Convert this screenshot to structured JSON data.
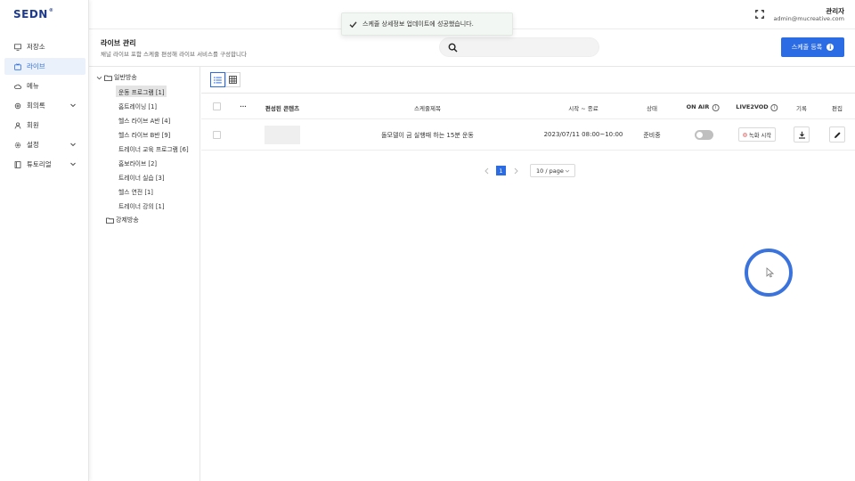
{
  "brand": {
    "logo": "SEDN",
    "logo_mark": "®"
  },
  "sidebar": {
    "items": [
      {
        "label": "저장소",
        "icon": "monitor-icon",
        "expandable": false,
        "active": false
      },
      {
        "label": "라이브",
        "icon": "live-tv-icon",
        "expandable": false,
        "active": true
      },
      {
        "label": "메뉴",
        "icon": "cloud-icon",
        "expandable": false,
        "active": false
      },
      {
        "label": "회의록",
        "icon": "gear-icon",
        "expandable": true,
        "active": false
      },
      {
        "label": "회원",
        "icon": "user-icon",
        "expandable": false,
        "active": false
      },
      {
        "label": "설정",
        "icon": "settings-icon",
        "expandable": true,
        "active": false
      },
      {
        "label": "튜토리얼",
        "icon": "book-icon",
        "expandable": true,
        "active": false
      }
    ]
  },
  "header": {
    "user_name": "관리자",
    "user_email": "admin@mucreative.com"
  },
  "toast": {
    "message": "스케줄 상세정보 업데이트에 성공했습니다."
  },
  "page": {
    "title": "라이브 관리",
    "subtitle": "채널 라이브 포함 스케줄 편성해 라이브 서비스를 구성합니다",
    "search_placeholder": "",
    "register_button": "스케줄 등록",
    "register_info": "i"
  },
  "tree": {
    "roots": [
      {
        "label": "일반방송",
        "expanded": true,
        "children": [
          {
            "label": "운동 프로그램 [1]",
            "selected": true
          },
          {
            "label": "홈트레이닝 [1]",
            "selected": false
          },
          {
            "label": "헬스 라이브 A반 [4]",
            "selected": false
          },
          {
            "label": "헬스 라이브 B반 [9]",
            "selected": false
          },
          {
            "label": "트레이너 교육 프로그램 [6]",
            "selected": false
          },
          {
            "label": "홈보라이브 [2]",
            "selected": false
          },
          {
            "label": "트레이너 실습 [3]",
            "selected": false
          },
          {
            "label": "헬스 연전 [1]",
            "selected": false
          },
          {
            "label": "트레이너 강의 [1]",
            "selected": false
          }
        ]
      },
      {
        "label": "강제방송",
        "expanded": false,
        "children": []
      }
    ]
  },
  "table": {
    "headers": {
      "more": "...",
      "content": "편성된 콘텐츠",
      "title": "스케줄제목",
      "time": "시작 ~ 종료",
      "status": "상태",
      "on_air": "ON AIR",
      "live2vod": "LIVE2VOD",
      "record": "기록",
      "edit": "편집",
      "info_mark": "i"
    },
    "rows": [
      {
        "title": "돌모델이 금 실행때 하는 15분 운동",
        "time": "2023/07/11 08:00~10:00",
        "status": "준비중",
        "on_air": false,
        "record_button": "녹화 시작"
      }
    ]
  },
  "pagination": {
    "current_page": "1",
    "page_size": "10 / page"
  },
  "colors": {
    "accent": "#2b6be3",
    "brand": "#1f3a8a",
    "toast_bg": "#f3f7f3"
  }
}
